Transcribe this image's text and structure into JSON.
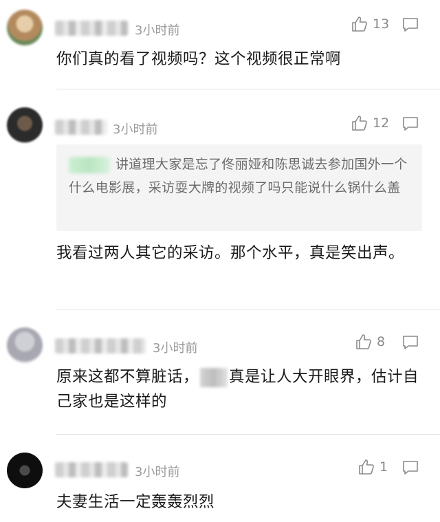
{
  "comments": [
    {
      "time": "3小时前",
      "likes": "13",
      "text": "你们真的看了视频吗？这个视频很正常啊",
      "avatar_colors": [
        "#c9a67a",
        "#8b6a4a"
      ]
    },
    {
      "time": "3小时前",
      "likes": "12",
      "quote": "讲道理大家是忘了佟丽娅和陈思诚去参加国外一个什么电影展，采访耍大牌的视频了吗只能说什么锅什么盖",
      "text": "我看过两人其它的采访。那个水平，真是笑出声。",
      "avatar_colors": [
        "#3a3a3a",
        "#7a6a5a"
      ]
    },
    {
      "time": "3小时前",
      "likes": "8",
      "text_before": "原来这都不算脏话，",
      "text_after": "真是让人大开眼界，估计自己家也是这样的",
      "avatar_colors": [
        "#b8b8c0",
        "#d8d8de"
      ]
    },
    {
      "time": "3小时前",
      "likes": "1",
      "text": "夫妻生活一定轰轰烈烈",
      "avatar_colors": [
        "#111111",
        "#3a3a3a"
      ]
    }
  ]
}
